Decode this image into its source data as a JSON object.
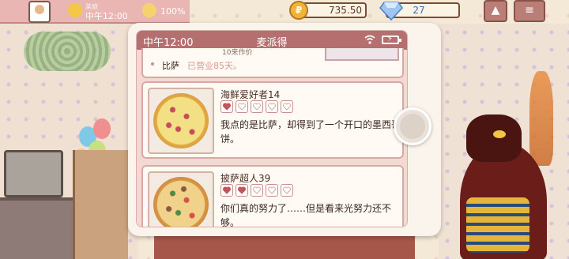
{
  "hud": {
    "clock": "中午12:00",
    "clock_sub": "美娘",
    "happiness": "100%",
    "coins": "735.50",
    "gems": "27"
  },
  "phone": {
    "time": "中午12:00",
    "title": "麦派得"
  },
  "partial_review": {
    "reviewer_fragment": "10来作价",
    "pizza_label": "比萨",
    "days_open": "已营业85天。"
  },
  "reviews": [
    {
      "reviewer": "海鲜爱好者14",
      "rating": 1,
      "max_rating": 5,
      "text": "我点的是比萨，却得到了一个开口的墨西哥饼。"
    },
    {
      "reviewer": "披萨超人39",
      "rating": 2,
      "max_rating": 5,
      "text": "你们真的努力了……但是看来光努力还不够。"
    }
  ],
  "colors": {
    "status_bar": "#b66f6f",
    "heart_filled": "#c0575c",
    "heart_empty": "#ffffff"
  }
}
